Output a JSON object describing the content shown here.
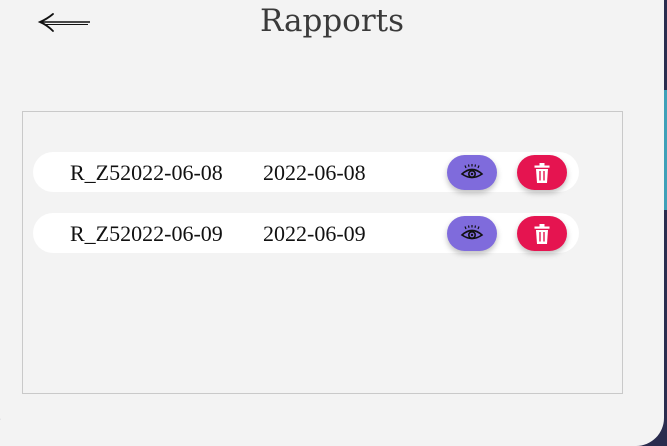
{
  "header": {
    "title": "Rapports",
    "back_icon": "left-arrow-icon"
  },
  "colors": {
    "view_button": "#7f6bdc",
    "delete_button": "#e51450",
    "panel": "#f3f3f3",
    "row": "#ffffff"
  },
  "reports": [
    {
      "name": "R_Z52022-06-08",
      "date": "2022-06-08",
      "view_icon": "eye-icon",
      "delete_icon": "trash-icon"
    },
    {
      "name": "R_Z52022-06-09",
      "date": "2022-06-09",
      "view_icon": "eye-icon",
      "delete_icon": "trash-icon"
    }
  ]
}
